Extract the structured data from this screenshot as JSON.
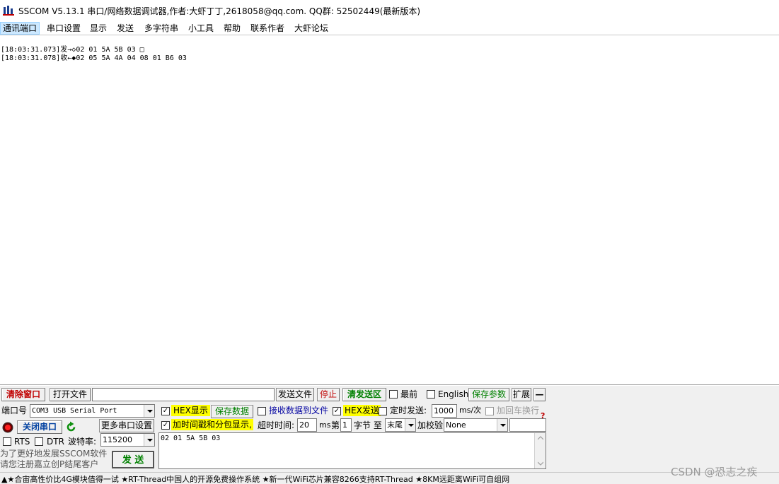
{
  "window": {
    "title": "SSCOM V5.13.1 串口/网络数据调试器,作者:大虾丁丁,2618058@qq.com. QQ群: 52502449(最新版本)",
    "icon": "sscom-app-icon"
  },
  "menu": {
    "items": [
      "通讯端口",
      "串口设置",
      "显示",
      "发送",
      "多字符串",
      "小工具",
      "帮助",
      "联系作者",
      "大虾论坛"
    ]
  },
  "log": {
    "lines": [
      "[18:03:31.073]发→◇02 01 5A 5B 03 □",
      "[18:03:31.078]收←◆02 05 5A 4A 04 08 01 B6 03"
    ]
  },
  "toolbar": {
    "clear_window": "清除窗口",
    "open_file": "打开文件",
    "file_path": "",
    "send_file": "发送文件",
    "stop": "停止",
    "clear_send": "清发送区",
    "topmost": "最前",
    "english": "English",
    "save_params": "保存参数",
    "expand": "扩展",
    "collapse": "—"
  },
  "port": {
    "port_label": "端口号",
    "port_value": "COM3 USB Serial Port",
    "close_port": "关闭串口",
    "more_settings": "更多串口设置",
    "rts": "RTS",
    "dtr": "DTR",
    "baud_label": "波特率:",
    "baud_value": "115200",
    "promo_line1": "为了更好地发展SSCOM软件",
    "promo_line2": "请您注册嘉立创P结尾客户"
  },
  "options": {
    "hex_display": "HEX显示",
    "save_data": "保存数据",
    "recv_to_file": "接收数据到文件",
    "hex_send": "HEX发送",
    "timed_send": "定时发送:",
    "interval": "1000",
    "interval_unit": "ms/次",
    "add_crlf": "加回车换行",
    "timestamp": "加时间戳和分包显示,",
    "timeout_label": "超时时间:",
    "timeout_value": "20",
    "timeout_unit": "ms",
    "nth_label": "第",
    "nth_value": "1",
    "byte_label": "字节 至",
    "end_value": "末尾",
    "checksum_label": "加校验",
    "checksum_value": "None",
    "send_button": "发  送"
  },
  "send_area": {
    "content": "02 01 5A 5B 03"
  },
  "status": {
    "text": "▲★合宙高性价比4G模块值得一试 ★RT-Thread中国人的开源免费操作系统 ★新一代WiFi芯片兼容8266支持RT-Thread ★8KM远距离WiFi可自组网"
  },
  "watermark": "CSDN @恐志之疾"
}
